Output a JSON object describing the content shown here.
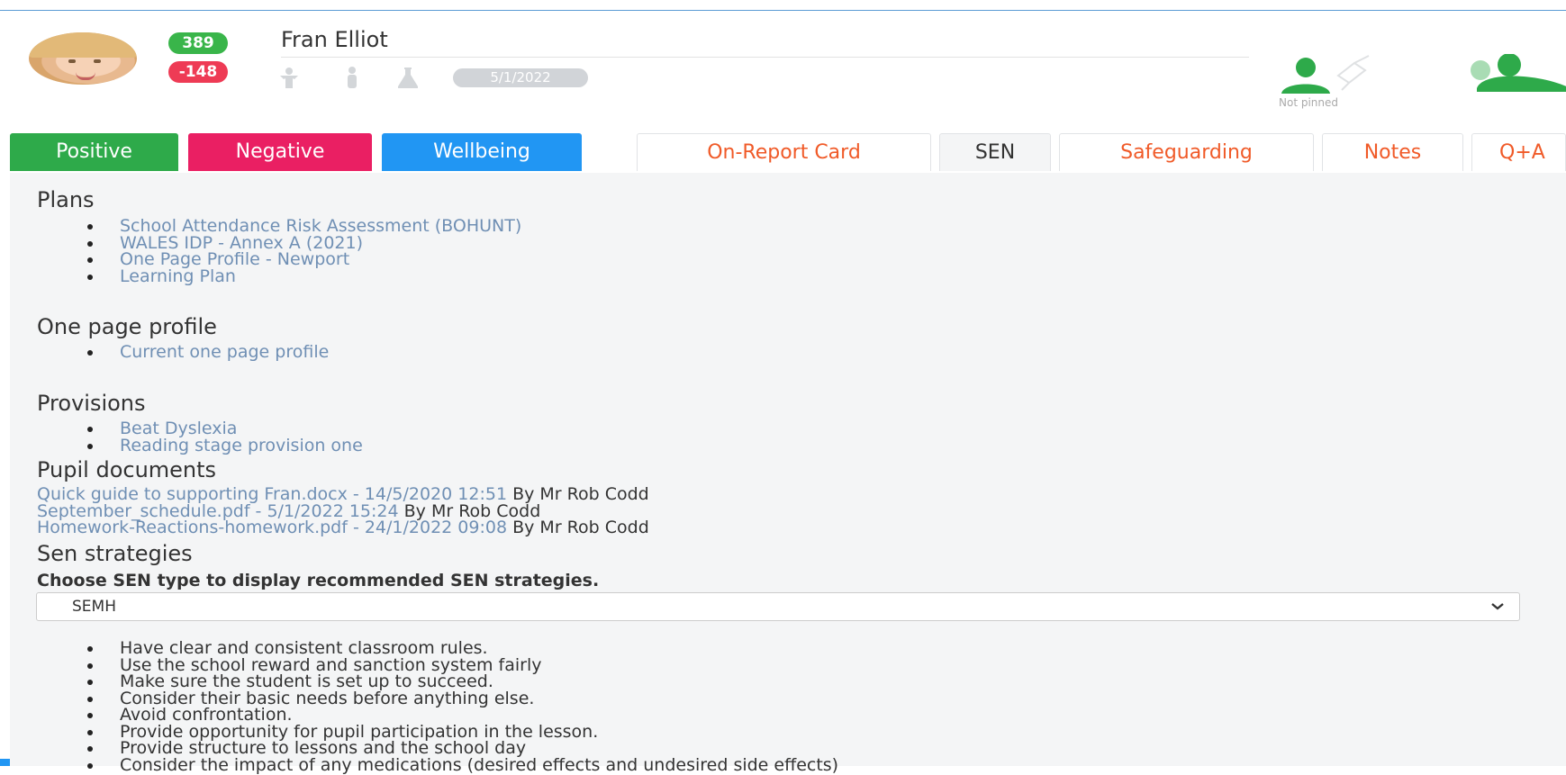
{
  "pupil": {
    "name": "Fran Elliot",
    "positive_score": "389",
    "negative_score": "-148",
    "date": "5/1/2022",
    "pin_status": "Not pinned"
  },
  "tabs": [
    "Positive",
    "Negative",
    "Wellbeing",
    "On-Report Card",
    "SEN",
    "Safeguarding",
    "Notes",
    "Q+A"
  ],
  "active_tab": "SEN",
  "sections": {
    "plans": {
      "title": "Plans",
      "items": [
        "School Attendance Risk Assessment (BOHUNT)",
        "WALES IDP - Annex A (2021)",
        "One Page Profile - Newport",
        "Learning Plan"
      ]
    },
    "one_page_profile": {
      "title": "One page profile",
      "items": [
        "Current one page profile"
      ]
    },
    "provisions": {
      "title": "Provisions",
      "items": [
        "Beat Dyslexia",
        "Reading stage provision one"
      ]
    },
    "pupil_documents": {
      "title": "Pupil documents",
      "items": [
        {
          "link": "Quick guide to supporting Fran.docx - 14/5/2020 12:51",
          "by": " By Mr Rob Codd"
        },
        {
          "link": "September_schedule.pdf - 5/1/2022 15:24",
          "by": " By Mr Rob Codd"
        },
        {
          "link": "Homework-Reactions-homework.pdf - 24/1/2022 09:08",
          "by": " By Mr Rob Codd"
        }
      ]
    },
    "sen_strategies": {
      "title": "Sen strategies",
      "prompt": "Choose SEN type to display recommended SEN strategies.",
      "selected_type": "SEMH",
      "items": [
        "Have clear and consistent classroom rules.",
        "Use the school reward and sanction system fairly",
        "Make sure the student is set up to succeed.",
        "Consider their basic needs before anything else.",
        "Avoid confrontation.",
        "Provide opportunity for pupil participation in the lesson.",
        "Provide structure to lessons and the school day",
        "Consider the impact of any medications (desired effects and undesired side effects)"
      ]
    }
  },
  "colors": {
    "positive": "#2eaa4a",
    "negative": "#ea1f63",
    "wellbeing": "#2196f3",
    "tab_text": "#f05a28",
    "link": "#6f8fb4"
  }
}
